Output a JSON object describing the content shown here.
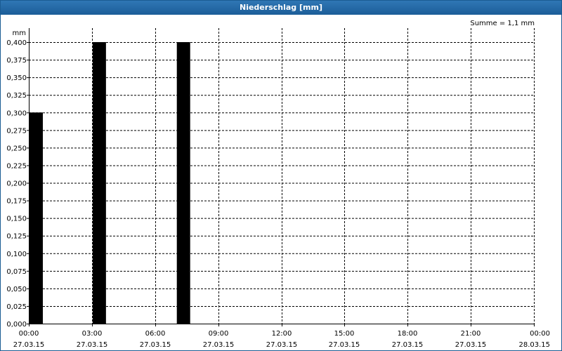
{
  "window": {
    "title": "Niederschlag [mm]"
  },
  "chart_data": {
    "type": "bar",
    "title": "Niederschlag [mm]",
    "summary": "Summe = 1,1 mm",
    "ylabel": "mm",
    "ylim": [
      0,
      0.4
    ],
    "y_ticks": [
      "0,000",
      "0,025",
      "0,050",
      "0,075",
      "0,100",
      "0,125",
      "0,150",
      "0,175",
      "0,200",
      "0,225",
      "0,250",
      "0,275",
      "0,300",
      "0,325",
      "0,350",
      "0,375",
      "0,400"
    ],
    "x_tick_times": [
      "00:00",
      "03:00",
      "06:00",
      "09:00",
      "12:00",
      "15:00",
      "18:00",
      "21:00",
      "00:00"
    ],
    "x_tick_dates": [
      "27.03.15",
      "27.03.15",
      "27.03.15",
      "27.03.15",
      "27.03.15",
      "27.03.15",
      "27.03.15",
      "27.03.15",
      "28.03.15"
    ],
    "x_range_hours": [
      0,
      24
    ],
    "bar_width_hours": 0.667,
    "categories": [
      "00:00",
      "03:00",
      "07:00"
    ],
    "bars": [
      {
        "x_hours": 0,
        "value": 0.3
      },
      {
        "x_hours": 3,
        "value": 0.4
      },
      {
        "x_hours": 7,
        "value": 0.4
      }
    ],
    "grid": true,
    "colors": {
      "bar": "#000000",
      "grid": "#000000",
      "title_bar": "#1f62a0"
    }
  }
}
